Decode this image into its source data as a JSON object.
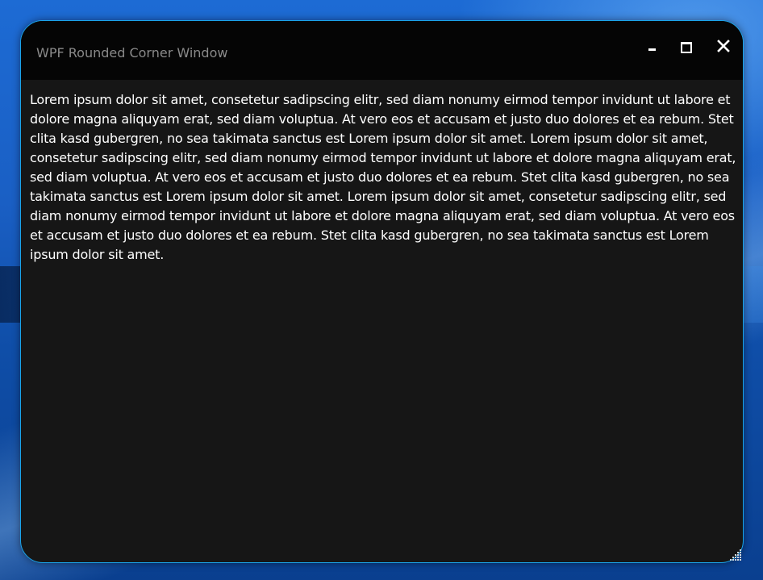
{
  "window": {
    "title": "WPF Rounded Corner Window",
    "border_color": "#1aa3e8",
    "background_color": "#161616",
    "titlebar_color": "#050505"
  },
  "caption_buttons": {
    "minimize_icon": "minimize-icon",
    "maximize_icon": "maximize-icon",
    "close_icon": "close-icon"
  },
  "content": {
    "text": "Lorem ipsum dolor sit amet, consetetur sadipscing elitr, sed diam nonumy eirmod tempor invidunt ut labore et dolore magna aliquyam erat, sed diam voluptua. At vero eos et accusam et justo duo dolores et ea rebum. Stet clita kasd gubergren, no sea takimata sanctus est Lorem ipsum dolor sit amet. Lorem ipsum dolor sit amet, consetetur sadipscing elitr, sed diam nonumy eirmod tempor invidunt ut labore et dolore magna aliquyam erat, sed diam voluptua. At vero eos et accusam et justo duo dolores et ea rebum. Stet clita kasd gubergren, no sea takimata sanctus est Lorem ipsum dolor sit amet. Lorem ipsum dolor sit amet, consetetur sadipscing elitr, sed diam nonumy eirmod tempor invidunt ut labore et dolore magna aliquyam erat, sed diam voluptua. At vero eos et accusam et justo duo dolores et ea rebum. Stet clita kasd gubergren, no sea takimata sanctus est Lorem ipsum dolor sit amet."
  },
  "resize_grip_icon": "resize-grip-icon"
}
